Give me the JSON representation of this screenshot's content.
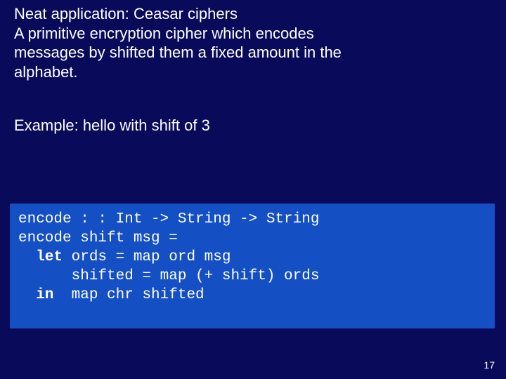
{
  "intro": {
    "line1": "Neat application: Ceasar ciphers",
    "line2": "A primitive encryption cipher which encodes",
    "line3": "messages by shifted them a fixed amount in the",
    "line4": "alphabet."
  },
  "example": "Example: hello with shift of 3",
  "code": {
    "l1a": "encode : : Int -> String -> String",
    "l2a": "encode shift msg =",
    "l3kw": "  let",
    "l3b": " ords = map ord msg",
    "l4a": "      shifted = map (+ shift) ords",
    "l5kw": "  in",
    "l5b": "  map chr shifted"
  },
  "page_number": "17"
}
